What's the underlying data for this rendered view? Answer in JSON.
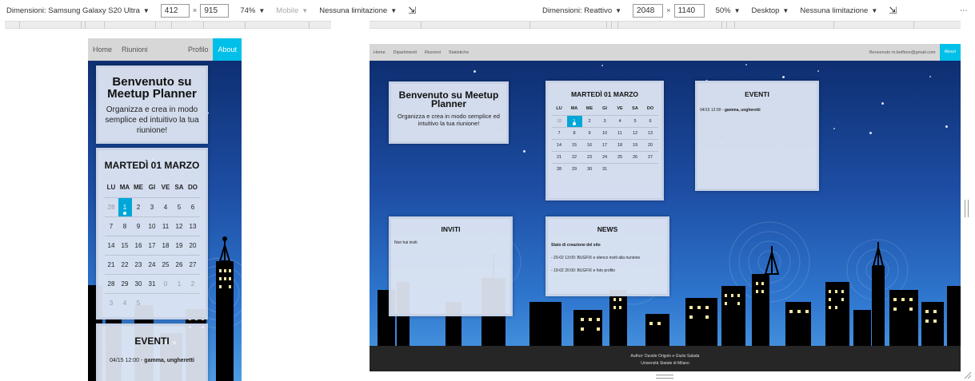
{
  "toolbar_mobile": {
    "dimensions": "Dimensioni: Samsung Galaxy S20 Ultra",
    "width": "412",
    "height": "915",
    "zoom": "74%",
    "mode": "Mobile",
    "throttle": "Nessuna limitazione"
  },
  "toolbar_desktop": {
    "dimensions": "Dimensioni: Reattivo",
    "width": "2048",
    "height": "1140",
    "zoom": "50%",
    "mode": "Desktop",
    "throttle": "Nessuna limitazione"
  },
  "times_sign": "×",
  "dropdown_arrow": "▼",
  "rotate_glyph": "⇲",
  "more_glyph": "⋯",
  "nav_mobile": [
    "Home",
    "Riunioni",
    "Profilo",
    "About"
  ],
  "nav_desktop": {
    "links": [
      "Home",
      "Dipartimenti",
      "Riunioni",
      "Statistiche"
    ],
    "user": "Benvenuto m.belfiore@gmail.com",
    "about": "About"
  },
  "welcome": {
    "title": "Benvenuto su Meetup Planner",
    "text": "Organizza e crea in modo semplice ed intuitivo la tua riunione!"
  },
  "calendar": {
    "title": "MARTEDÌ 01 MARZO",
    "weekdays": [
      "LU",
      "MA",
      "ME",
      "GI",
      "VE",
      "SA",
      "DO"
    ],
    "rows": [
      [
        "28",
        "1",
        "2",
        "3",
        "4",
        "5",
        "6"
      ],
      [
        "7",
        "8",
        "9",
        "10",
        "11",
        "12",
        "13"
      ],
      [
        "14",
        "15",
        "16",
        "17",
        "18",
        "19",
        "20"
      ],
      [
        "21",
        "22",
        "23",
        "24",
        "25",
        "26",
        "27"
      ],
      [
        "28",
        "29",
        "30",
        "31",
        "",
        "",
        ""
      ]
    ],
    "mobile_rows": [
      [
        "28",
        "1",
        "2",
        "3",
        "4",
        "5",
        "6"
      ],
      [
        "7",
        "8",
        "9",
        "10",
        "11",
        "12",
        "13"
      ],
      [
        "14",
        "15",
        "16",
        "17",
        "18",
        "19",
        "20"
      ],
      [
        "21",
        "22",
        "23",
        "24",
        "25",
        "26",
        "27"
      ],
      [
        "28",
        "29",
        "30",
        "31",
        "0",
        "1",
        "2"
      ],
      [
        "3",
        "4",
        "5",
        "",
        "",
        "",
        ""
      ]
    ]
  },
  "events": {
    "title": "EVENTI",
    "time": "04/15 12:00",
    "separator": "-",
    "name": "gamma, ungheretti"
  },
  "invites": {
    "title": "INVITI",
    "empty": "Non hai inviti"
  },
  "news": {
    "title": "NEWS",
    "heading": "Stato di creazione del sito",
    "items": [
      "- 20-02 13:00: BUGFIX e elenco inviti alla riunione",
      "- 19-02 20:00: BUGFIX e foto profilo"
    ]
  },
  "footer": {
    "author": "Author: Davide Origolo e Giulio Salada",
    "university": "Università Statale di Milano"
  },
  "colors": {
    "accent": "#00bfe8",
    "navbar": "#d7d7d7",
    "footer": "#262626",
    "sky_top": "#0c2a6a",
    "sky_bottom": "#4e9be2"
  }
}
